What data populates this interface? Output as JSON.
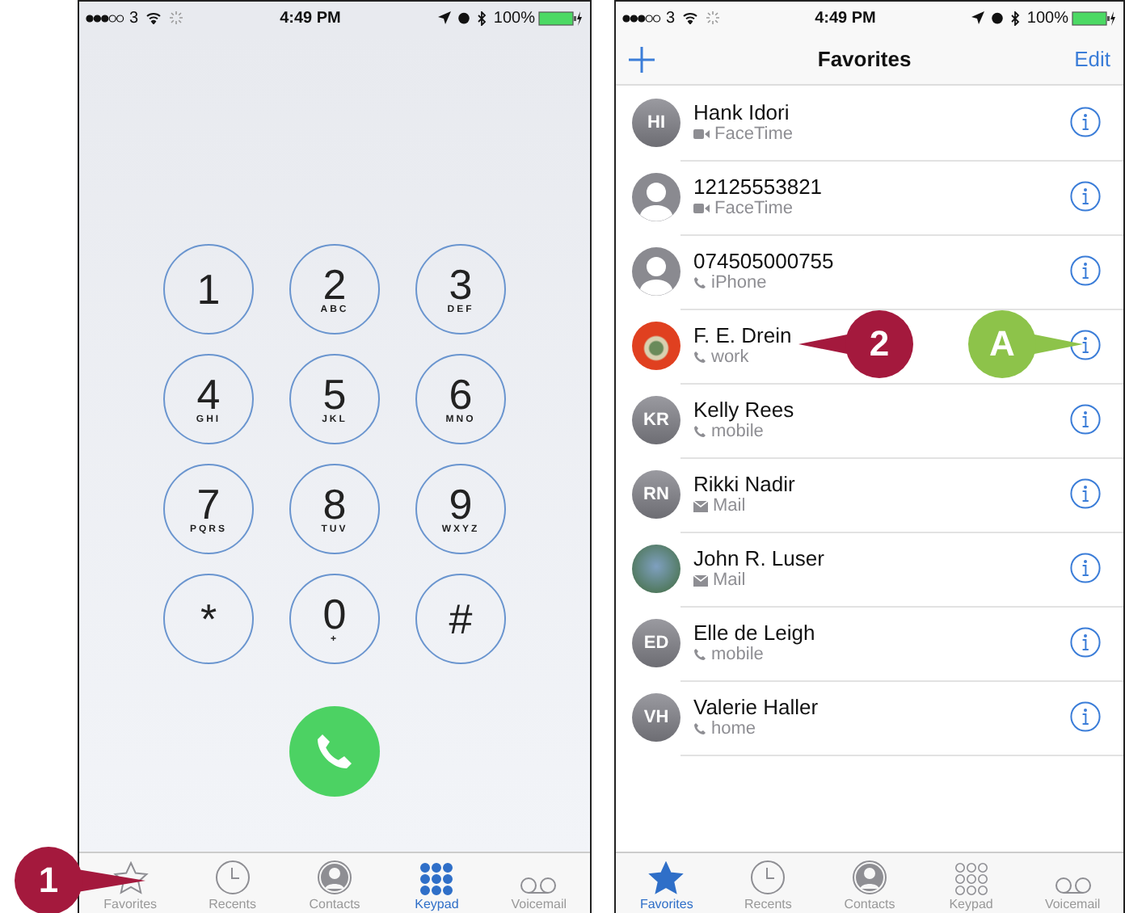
{
  "keypad_screen": {
    "status_bar": {
      "carrier": "3",
      "time": "4:49 PM",
      "battery": "100%"
    },
    "keys": [
      {
        "digit": "1"
      },
      {
        "digit": "2",
        "letters": "ABC"
      },
      {
        "digit": "3",
        "letters": "DEF"
      },
      {
        "digit": "4",
        "letters": "GHI"
      },
      {
        "digit": "5",
        "letters": "JKL"
      },
      {
        "digit": "6",
        "letters": "MNO"
      },
      {
        "digit": "7",
        "letters": "PQRS"
      },
      {
        "digit": "8",
        "letters": "TUV"
      },
      {
        "digit": "9",
        "letters": "WXYZ"
      },
      {
        "digit": "*"
      },
      {
        "digit": "0",
        "letters": "+"
      },
      {
        "digit": "#"
      }
    ],
    "tabs": [
      {
        "kind": "favorites",
        "label": "Favorites",
        "selected": false
      },
      {
        "kind": "recents",
        "label": "Recents",
        "selected": false
      },
      {
        "kind": "contacts",
        "label": "Contacts",
        "selected": false
      },
      {
        "kind": "keypad",
        "label": "Keypad",
        "selected": true
      },
      {
        "kind": "voicemail",
        "label": "Voicemail",
        "selected": false
      }
    ]
  },
  "favorites_screen": {
    "status_bar": {
      "carrier": "3",
      "time": "4:49 PM",
      "battery": "100%"
    },
    "title": "Favorites",
    "edit": "Edit",
    "contacts": [
      {
        "name": "Hank Idori",
        "avatar": {
          "kind": "initials",
          "initials": "HI"
        },
        "kind": "facetime",
        "label": "FaceTime"
      },
      {
        "name": "12125553821",
        "avatar": {
          "kind": "silhouette"
        },
        "kind": "facetime",
        "label": "FaceTime"
      },
      {
        "name": "074505000755",
        "avatar": {
          "kind": "silhouette"
        },
        "kind": "phone",
        "label": "iPhone"
      },
      {
        "name": "F. E. Drein",
        "avatar": {
          "kind": "photo"
        },
        "kind": "phone",
        "label": "work"
      },
      {
        "name": "Kelly Rees",
        "avatar": {
          "kind": "initials",
          "initials": "KR"
        },
        "kind": "phone",
        "label": "mobile"
      },
      {
        "name": "Rikki Nadir",
        "avatar": {
          "kind": "initials",
          "initials": "RN"
        },
        "kind": "mail",
        "label": "Mail"
      },
      {
        "name": "John R. Luser",
        "avatar": {
          "kind": "photo"
        },
        "kind": "mail",
        "label": "Mail"
      },
      {
        "name": "Elle de Leigh",
        "avatar": {
          "kind": "initials",
          "initials": "ED"
        },
        "kind": "phone",
        "label": "mobile"
      },
      {
        "name": "Valerie Haller",
        "avatar": {
          "kind": "initials",
          "initials": "VH"
        },
        "kind": "phone",
        "label": "home"
      }
    ],
    "tabs": [
      {
        "kind": "favorites",
        "label": "Favorites",
        "selected": true
      },
      {
        "kind": "recents",
        "label": "Recents",
        "selected": false
      },
      {
        "kind": "contacts",
        "label": "Contacts",
        "selected": false
      },
      {
        "kind": "keypad",
        "label": "Keypad",
        "selected": false
      },
      {
        "kind": "voicemail",
        "label": "Voicemail",
        "selected": false
      }
    ]
  },
  "callouts": [
    {
      "label": "1",
      "color": "#a4193d"
    },
    {
      "label": "2",
      "color": "#a4193d"
    },
    {
      "label": "A",
      "color": "#8dc34a"
    }
  ]
}
